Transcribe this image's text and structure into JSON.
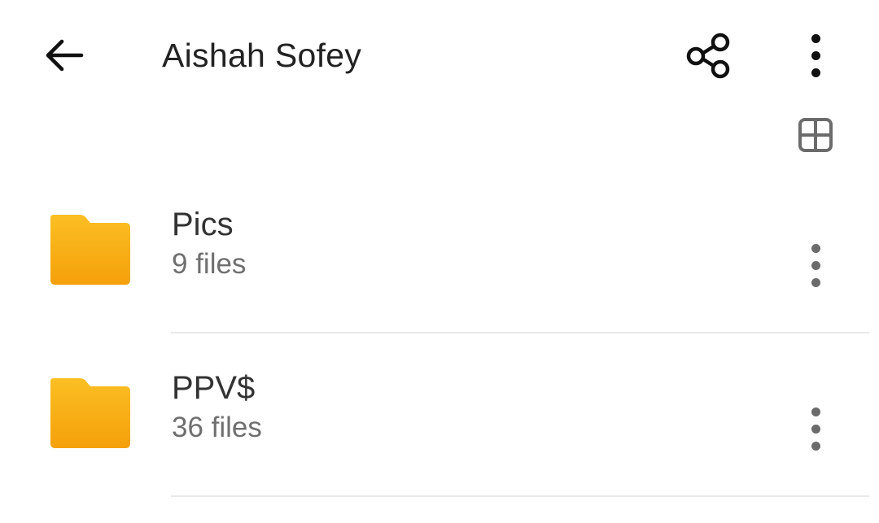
{
  "header": {
    "title": "Aishah Sofey",
    "back_icon": "arrow-back-icon",
    "share_icon": "share-icon",
    "more_icon": "more-vert-icon"
  },
  "toolbar": {
    "view_toggle_icon": "grid-view-icon"
  },
  "folders": [
    {
      "name": "Pics",
      "count": "9 files"
    },
    {
      "name": "PPV$",
      "count": "36 files"
    }
  ],
  "colors": {
    "folder_top": "#FBBF24",
    "folder_bottom": "#F5A00A",
    "divider": "#E9E9E9",
    "secondary_text": "#6F6F6F"
  }
}
